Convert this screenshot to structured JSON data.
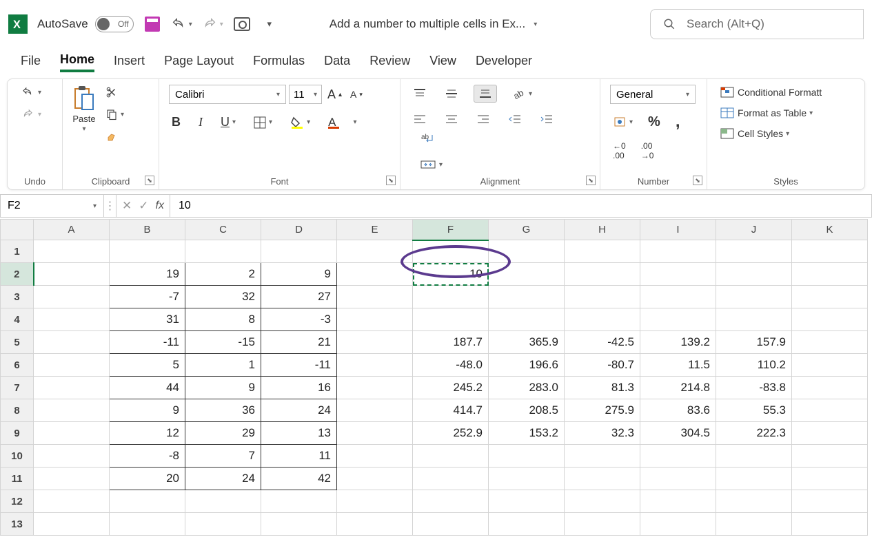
{
  "titlebar": {
    "autosave_label": "AutoSave",
    "autosave_state": "Off",
    "doc_title": "Add a number to multiple cells in Ex...",
    "search_placeholder": "Search (Alt+Q)"
  },
  "tabs": [
    "File",
    "Home",
    "Insert",
    "Page Layout",
    "Formulas",
    "Data",
    "Review",
    "View",
    "Developer"
  ],
  "active_tab": "Home",
  "ribbon": {
    "undo_label": "Undo",
    "clipboard_label": "Clipboard",
    "paste_label": "Paste",
    "font_label": "Font",
    "font_name": "Calibri",
    "font_size": "11",
    "alignment_label": "Alignment",
    "number_label": "Number",
    "number_format": "General",
    "styles_label": "Styles",
    "cond_fmt": "Conditional Formatt",
    "table_fmt": "Format as Table",
    "cell_styles": "Cell Styles"
  },
  "formula_bar": {
    "name_box": "F2",
    "formula": "10"
  },
  "columns": [
    "A",
    "B",
    "C",
    "D",
    "E",
    "F",
    "G",
    "H",
    "I",
    "J",
    "K"
  ],
  "rows": [
    "1",
    "2",
    "3",
    "4",
    "5",
    "6",
    "7",
    "8",
    "9",
    "10",
    "11",
    "12",
    "13"
  ],
  "selected_col": "F",
  "selected_row": "2",
  "cells": {
    "B2": "19",
    "C2": "2",
    "D2": "9",
    "F2": "10",
    "B3": "-7",
    "C3": "32",
    "D3": "27",
    "B4": "31",
    "C4": "8",
    "D4": "-3",
    "B5": "-11",
    "C5": "-15",
    "D5": "21",
    "F5": "187.7",
    "G5": "365.9",
    "H5": "-42.5",
    "I5": "139.2",
    "J5": "157.9",
    "B6": "5",
    "C6": "1",
    "D6": "-11",
    "F6": "-48.0",
    "G6": "196.6",
    "H6": "-80.7",
    "I6": "11.5",
    "J6": "110.2",
    "B7": "44",
    "C7": "9",
    "D7": "16",
    "F7": "245.2",
    "G7": "283.0",
    "H7": "81.3",
    "I7": "214.8",
    "J7": "-83.8",
    "B8": "9",
    "C8": "36",
    "D8": "24",
    "F8": "414.7",
    "G8": "208.5",
    "H8": "275.9",
    "I8": "83.6",
    "J8": "55.3",
    "B9": "12",
    "C9": "29",
    "D9": "13",
    "F9": "252.9",
    "G9": "153.2",
    "H9": "32.3",
    "I9": "304.5",
    "J9": "222.3",
    "B10": "-8",
    "C10": "7",
    "D10": "11",
    "B11": "20",
    "C11": "24",
    "D11": "42"
  },
  "bordered_range": {
    "cols": [
      "B",
      "C",
      "D"
    ],
    "rows": [
      "2",
      "3",
      "4",
      "5",
      "6",
      "7",
      "8",
      "9",
      "10",
      "11"
    ]
  }
}
